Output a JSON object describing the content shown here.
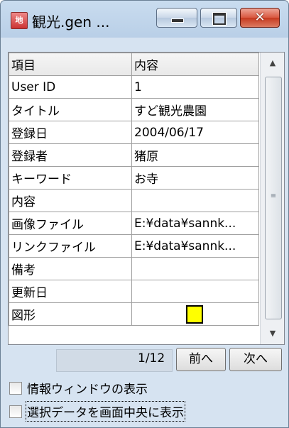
{
  "window": {
    "title": "観光.gen ...",
    "app_icon_text": "地",
    "min_icon": "minimize-icon",
    "max_icon": "maximize-icon",
    "close_icon": "close-icon",
    "close_glyph": "✕"
  },
  "grid": {
    "headers": [
      "項目",
      "内容"
    ],
    "rows": [
      {
        "label": "User ID",
        "value": "1"
      },
      {
        "label": "タイトル",
        "value": "すど観光農園"
      },
      {
        "label": "登録日",
        "value": "2004/06/17"
      },
      {
        "label": "登録者",
        "value": "猪原"
      },
      {
        "label": "キーワード",
        "value": "お寺"
      },
      {
        "label": "内容",
        "value": ""
      },
      {
        "label": "画像ファイル",
        "value": "E:¥data¥sannk..."
      },
      {
        "label": "リンクファイル",
        "value": "E:¥data¥sannk..."
      },
      {
        "label": "備考",
        "value": ""
      },
      {
        "label": "更新日",
        "value": ""
      },
      {
        "label": "図形",
        "value": ""
      }
    ],
    "shape_color": "#ffff00",
    "scroll_up_glyph": "▲",
    "scroll_down_glyph": "▼",
    "scroll_grip_glyph": "≡"
  },
  "pager": {
    "page_text": "1/12",
    "prev_label": "前へ",
    "next_label": "次へ"
  },
  "options": {
    "show_info_window_label": "情報ウィンドウの表示",
    "center_selection_label": "選択データを画面中央に表示",
    "show_info_window_checked": false,
    "center_selection_checked": false
  }
}
